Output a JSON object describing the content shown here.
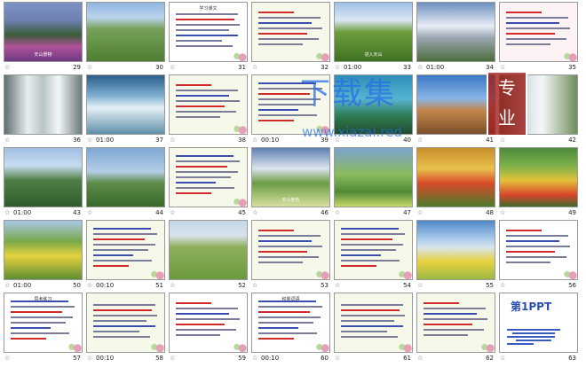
{
  "app": {
    "view": "slide-sorter"
  },
  "slides": [
    {
      "num": "29",
      "timing": "",
      "kind": "photo",
      "bg": "linear-gradient(180deg,#7d93c5 0%,#6e7fb0 30%,#3b5d3a 55%,#b0529a 75%,#6c3a80 100%)",
      "caption": "天山景物"
    },
    {
      "num": "30",
      "timing": "",
      "kind": "photo",
      "bg": "linear-gradient(180deg,#8fb5e0 0%,#bcd3ee 25%,#77a15a 45%,#4e7f32 100%)",
      "caption": ""
    },
    {
      "num": "31",
      "timing": "",
      "kind": "text",
      "variant": "white",
      "caption": "学习课文"
    },
    {
      "num": "32",
      "timing": "",
      "kind": "text",
      "variant": "",
      "caption": ""
    },
    {
      "num": "33",
      "timing": "01:00",
      "kind": "photo",
      "bg": "linear-gradient(180deg,#9fc0e8 0%,#dbe7f4 30%,#6f9d3d 50%,#3f7123 100%)",
      "caption": "进入天山"
    },
    {
      "num": "34",
      "timing": "01:00",
      "kind": "photo",
      "bg": "linear-gradient(180deg,#6d8fbf 0%,#e9eef6 40%,#9aa6b3 60%,#4c6c3c 100%)",
      "caption": ""
    },
    {
      "num": "35",
      "timing": "",
      "kind": "text",
      "variant": "pink",
      "caption": ""
    },
    {
      "num": "36",
      "timing": "",
      "kind": "photo",
      "bg": "linear-gradient(90deg,#5f6e70 0%,#e8eef0 30%,#b7c4c6 50%,#f3f7f8 70%,#6a7a7c 100%)",
      "caption": ""
    },
    {
      "num": "37",
      "timing": "01:00",
      "kind": "photo",
      "bg": "linear-gradient(180deg,#2a5d88 0%,#7fb0d2 35%,#e6f0f6 55%,#5f8fa8 100%)",
      "caption": ""
    },
    {
      "num": "38",
      "timing": "",
      "kind": "text",
      "variant": "",
      "caption": ""
    },
    {
      "num": "39",
      "timing": "00:10",
      "kind": "text",
      "variant": "",
      "caption": ""
    },
    {
      "num": "40",
      "timing": "",
      "kind": "photo",
      "bg": "linear-gradient(180deg,#2e8db5 0%,#56b4d3 40%,#2f7a4f 70%,#1f4d2f 100%)",
      "caption": ""
    },
    {
      "num": "41",
      "timing": "",
      "kind": "photo",
      "bg": "linear-gradient(180deg,#3b78c6 0%,#8ab6e4 40%,#c2864a 60%,#7a4f2a 100%)",
      "caption": ""
    },
    {
      "num": "42",
      "timing": "",
      "kind": "photo",
      "bg": "linear-gradient(90deg,#4e7a3a 0%,#dfe8ee 40%,#f4f7f9 55%,#6f8d5c 100%)",
      "caption": ""
    },
    {
      "num": "43",
      "timing": "01:00",
      "kind": "photo",
      "bg": "linear-gradient(180deg,#9ebfe2 0%,#c8dcef 30%,#4f7f45 55%,#2e5c2c 100%)",
      "caption": ""
    },
    {
      "num": "44",
      "timing": "",
      "kind": "photo",
      "bg": "linear-gradient(180deg,#7ea7d4 0%,#b5cde6 40%,#5c8c46 60%,#3a6a2a 100%)",
      "caption": ""
    },
    {
      "num": "45",
      "timing": "",
      "kind": "text",
      "variant": "",
      "caption": ""
    },
    {
      "num": "46",
      "timing": "",
      "kind": "photo",
      "bg": "linear-gradient(180deg,#5d7fb3 0%,#dbe4ee 35%,#6a9c44 60%,#d8e0a0 100%)",
      "caption": "天山景色"
    },
    {
      "num": "47",
      "timing": "",
      "kind": "photo",
      "bg": "linear-gradient(180deg,#7aa3d0 0%,#8cba5c 45%,#4f8a34 75%,#c7d76a 100%)",
      "caption": ""
    },
    {
      "num": "48",
      "timing": "",
      "kind": "photo",
      "bg": "linear-gradient(180deg,#c98c2b 0%,#e8c24c 35%,#d94b2a 60%,#4d7a2c 100%)",
      "caption": ""
    },
    {
      "num": "49",
      "timing": "",
      "kind": "photo",
      "bg": "linear-gradient(180deg,#4d8a3c 0%,#7bb04a 30%,#e2c23a 55%,#d9452b 80%,#3f6d2a 100%)",
      "caption": ""
    },
    {
      "num": "50",
      "timing": "01:00",
      "kind": "photo",
      "bg": "linear-gradient(180deg,#a9c8e8 0%,#79a94a 35%,#e5d13e 60%,#5f8d33 100%)",
      "caption": ""
    },
    {
      "num": "51",
      "timing": "00:10",
      "kind": "text",
      "variant": "",
      "caption": ""
    },
    {
      "num": "52",
      "timing": "",
      "kind": "photo",
      "bg": "linear-gradient(180deg,#c3d6e8 0%,#d9e4ec 25%,#8db05a 45%,#6d9a3e 100%)",
      "caption": ""
    },
    {
      "num": "53",
      "timing": "",
      "kind": "text",
      "variant": "",
      "caption": ""
    },
    {
      "num": "54",
      "timing": "",
      "kind": "text",
      "variant": "",
      "caption": ""
    },
    {
      "num": "55",
      "timing": "",
      "kind": "photo",
      "bg": "linear-gradient(180deg,#4f86c8 0%,#a7c9ea 30%,#d9e4ee 45%,#e8d23e 70%,#9ab845 100%)",
      "caption": ""
    },
    {
      "num": "56",
      "timing": "",
      "kind": "text",
      "variant": "white",
      "caption": ""
    },
    {
      "num": "57",
      "timing": "",
      "kind": "text",
      "variant": "white",
      "caption": "思考练习"
    },
    {
      "num": "58",
      "timing": "00:10",
      "kind": "text",
      "variant": "",
      "caption": ""
    },
    {
      "num": "59",
      "timing": "",
      "kind": "text",
      "variant": "white",
      "caption": ""
    },
    {
      "num": "60",
      "timing": "00:10",
      "kind": "text",
      "variant": "white",
      "caption": "积累词语"
    },
    {
      "num": "61",
      "timing": "",
      "kind": "text",
      "variant": "",
      "caption": ""
    },
    {
      "num": "62",
      "timing": "",
      "kind": "text",
      "variant": "",
      "caption": ""
    },
    {
      "num": "63",
      "timing": "",
      "kind": "ppt",
      "variant": "white",
      "caption": ""
    }
  ],
  "watermark": {
    "title": "下载集",
    "url": "www.xiazai.red",
    "seal": [
      "专",
      "业"
    ]
  },
  "ppt_logo": "第1PPT"
}
